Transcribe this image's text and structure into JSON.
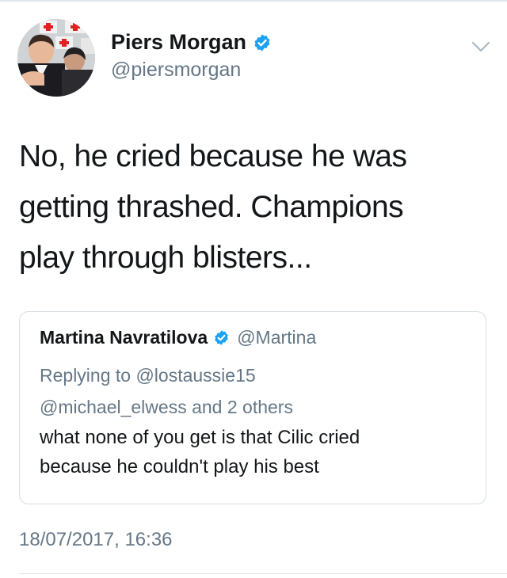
{
  "tweet": {
    "author": {
      "display_name": "Piers Morgan",
      "handle": "@piersmorgan",
      "verified_icon": "verified-badge-icon"
    },
    "menu_icon": "chevron-down-icon",
    "text_lines": [
      "No, he cried because he was",
      "getting thrashed. Champions",
      "play through blisters..."
    ],
    "timestamp": "18/07/2017, 16:36"
  },
  "quoted_tweet": {
    "display_name": "Martina Navratilova",
    "handle": "@Martina",
    "verified_icon": "verified-badge-icon",
    "reply_lines": [
      "Replying to @lostaussie15",
      "@michael_elwess and 2 others"
    ],
    "text_lines": [
      "what none of you get is that Cilic cried",
      "because he couldn't play his best"
    ]
  },
  "colors": {
    "verified_blue": "#1da1f2",
    "secondary_text": "#657786",
    "primary_text": "#14171a",
    "border": "#d8dee3"
  }
}
